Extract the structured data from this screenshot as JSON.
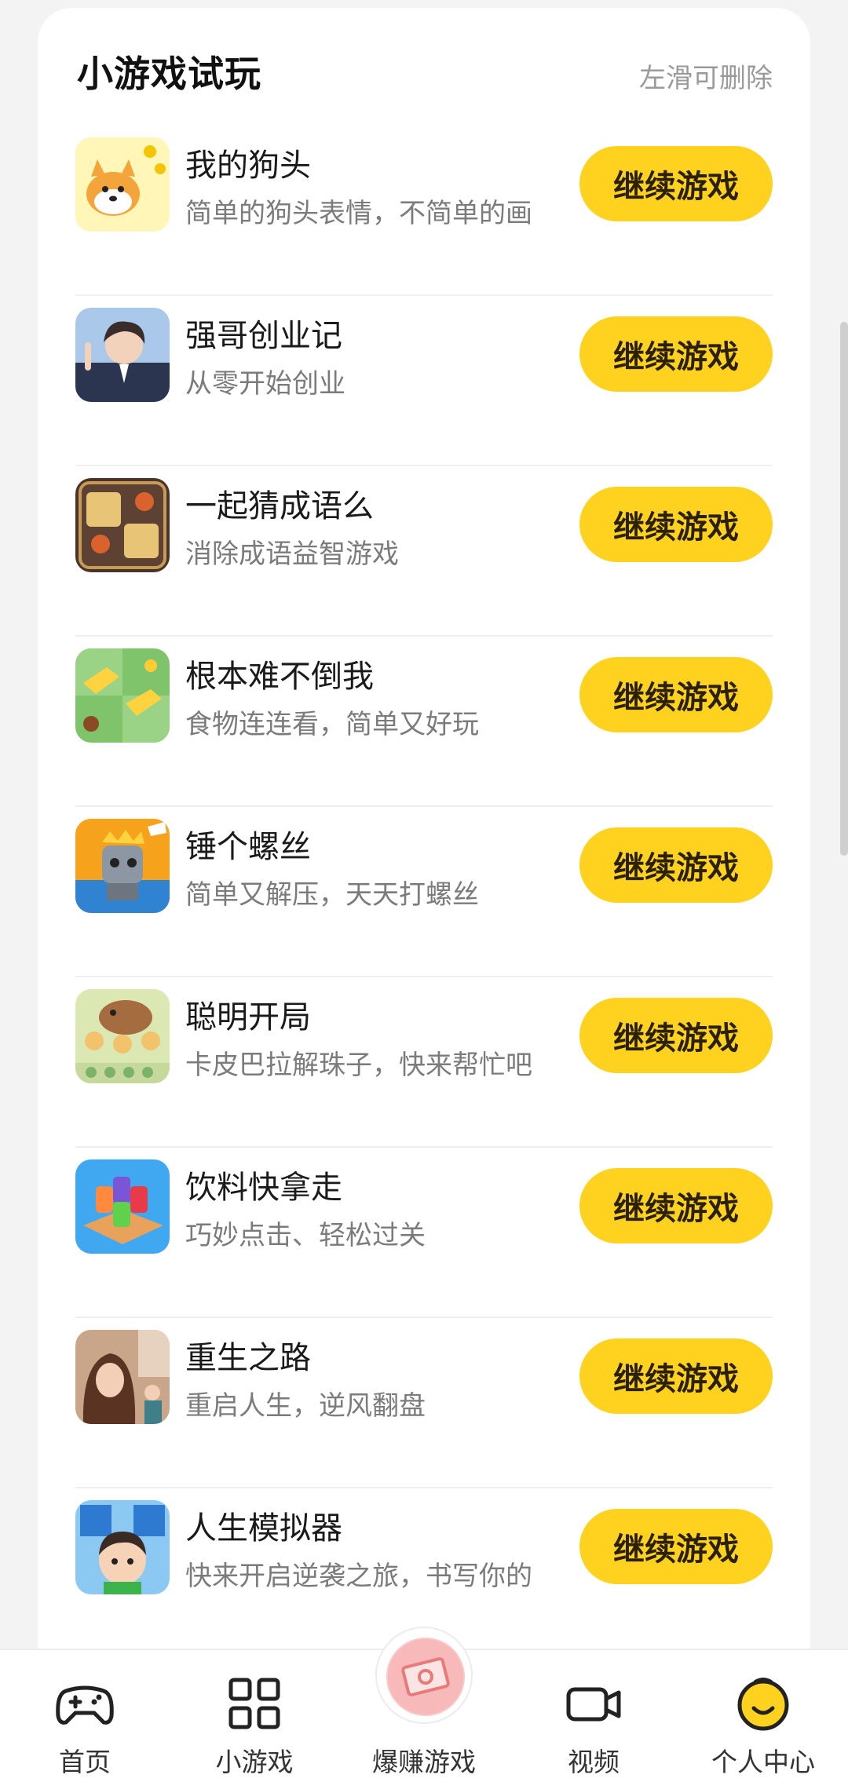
{
  "section": {
    "title": "小游戏试玩",
    "hint": "左滑可删除"
  },
  "continue_label": "继续游戏",
  "games": [
    {
      "name": "我的狗头",
      "desc": "简单的狗头表情，不简单的画",
      "icon": "doge-icon"
    },
    {
      "name": "强哥创业记",
      "desc": "从零开始创业",
      "icon": "businessman-icon"
    },
    {
      "name": "一起猜成语么",
      "desc": "消除成语益智游戏",
      "icon": "idiom-icon"
    },
    {
      "name": "根本难不倒我",
      "desc": "食物连连看，简单又好玩",
      "icon": "cheese-icon"
    },
    {
      "name": "锤个螺丝",
      "desc": "简单又解压，天天打螺丝",
      "icon": "screw-icon"
    },
    {
      "name": "聪明开局",
      "desc": "卡皮巴拉解珠子，快来帮忙吧",
      "icon": "capybara-icon"
    },
    {
      "name": "饮料快拿走",
      "desc": "巧妙点击、轻松过关",
      "icon": "drinks-icon"
    },
    {
      "name": "重生之路",
      "desc": "重启人生，逆风翻盘",
      "icon": "rebirth-icon"
    },
    {
      "name": "人生模拟器",
      "desc": "快来开启逆袭之旅，书写你的",
      "icon": "life-sim-icon"
    }
  ],
  "nav": [
    {
      "label": "首页",
      "icon": "gamepad-icon"
    },
    {
      "label": "小游戏",
      "icon": "grid-icon"
    },
    {
      "label": "爆赚游戏",
      "icon": "money-icon"
    },
    {
      "label": "视频",
      "icon": "video-icon"
    },
    {
      "label": "个人中心",
      "icon": "profile-icon"
    }
  ],
  "colors": {
    "button": "#ffd21f",
    "background": "#f3f3f3",
    "card": "#ffffff",
    "accent_pink": "#f9c9c9"
  }
}
